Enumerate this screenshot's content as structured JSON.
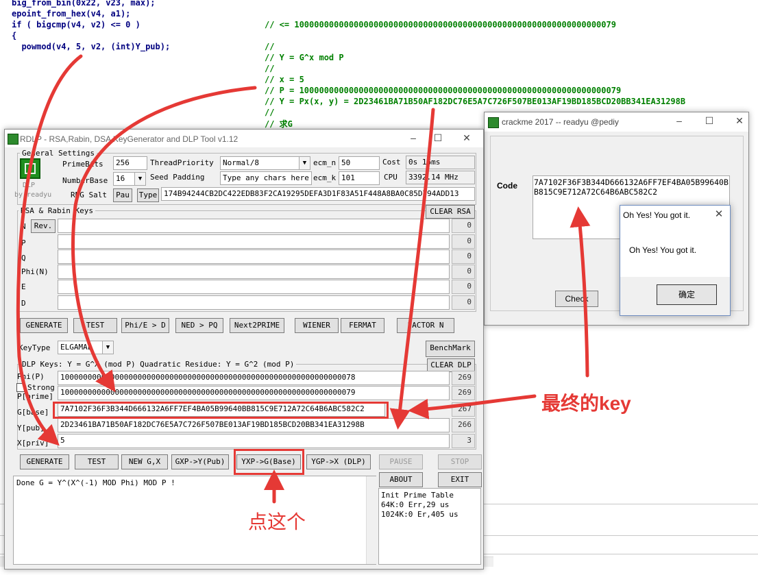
{
  "code": {
    "lines": [
      "big_from_bin(0x22, v23, max);",
      "epoint_from_hex(v4, a1);",
      "if ( bigcmp(v4, v2) <= 0 )",
      "{",
      "  powmod(v4, 5, v2, (int)Y_pub);"
    ],
    "comments": [
      "// <= 10000000000000000000000000000000000000000000000000000000000000079",
      "//",
      "// Y = G^x mod P",
      "//",
      "// x = 5",
      "// P = 10000000000000000000000000000000000000000000000000000000000000079",
      "// Y = Px(x, y) = 2D23461BA71B50AF182DC76E5A7C726F507BE013AF19BD185BCD20BB341EA31298B",
      "//",
      "// 求G"
    ]
  },
  "rdlp": {
    "title": "RDLP - RSA,Rabin, DSA KeyGenerator and DLP Tool v1.12",
    "logo_caption": "DLP",
    "author": "by readyu",
    "general": {
      "caption": "General Settings",
      "primebits_label": "PrimeBits",
      "primebits_value": "256",
      "threadpriority_label": "ThreadPriority",
      "threadpriority_value": "Normal/8",
      "ecm_n_label": "ecm_n",
      "ecm_n_value": "50",
      "cost_label": "Cost",
      "cost_value": "0s 16ms",
      "numberbase_label": "NumberBase",
      "numberbase_value": "16",
      "seedpadding_label": "Seed Padding",
      "seedpadding_value": "Type any chars here",
      "ecm_k_label": "ecm_k",
      "ecm_k_value": "101",
      "cpu_label": "CPU",
      "cpu_value": "3392.14 MHz",
      "rng_label": "RNG Salt",
      "pau_label": "Pau",
      "type_label": "Type",
      "rng_value": "174B94244CB2DC422EDB83F2CA19295DEFA3D1F83A51F448A8BA0C85D794ADD13"
    },
    "rsa": {
      "caption": "RSA & Rabin Keys",
      "clear_label": "CLEAR RSA",
      "rows": [
        {
          "label": "N",
          "value": "",
          "count": "0"
        },
        {
          "label": "P",
          "value": "",
          "count": "0"
        },
        {
          "label": "Q",
          "value": "",
          "count": "0"
        },
        {
          "label": "Phi(N)",
          "value": "",
          "count": "0"
        },
        {
          "label": "E",
          "value": "",
          "count": "0"
        },
        {
          "label": "D",
          "value": "",
          "count": "0"
        }
      ],
      "rev_label": "Rev.",
      "buttons": [
        "GENERATE",
        "TEST",
        "Phi/E > D",
        "NED > PQ",
        "Next2PRIME",
        "WIENER",
        "FERMAT",
        "FACTOR N"
      ]
    },
    "keytype": {
      "label": "KeyType",
      "value": "ELGAMAL",
      "benchmark": "BenchMark"
    },
    "dlp": {
      "caption": "DLP Keys: Y = G^X (mod P)  Quadratic Residue: Y = G^2 (mod P)",
      "clear_label": "CLEAR DLP",
      "strong_label": "Strong",
      "rows": [
        {
          "label": "Phi(P)",
          "value": "10000000000000000000000000000000000000000000000000000000000000078",
          "count": "269"
        },
        {
          "label": "P[prime]",
          "value": "10000000000000000000000000000000000000000000000000000000000000079",
          "count": "269"
        },
        {
          "label": "G[base]",
          "value": "7A7102F36F3B344D666132A6FF7EF4BA05B99640BB815C9E712A72C64B6ABC582C2",
          "count": "267"
        },
        {
          "label": "Y[pub]",
          "value": "2D23461BA71B50AF182DC76E5A7C726F507BE013AF19BD185BCD20BB341EA31298B",
          "count": "266"
        },
        {
          "label": "X[priv]",
          "value": "5",
          "count": "3"
        }
      ],
      "buttons": [
        "GENERATE",
        "TEST",
        "NEW G,X",
        "GXP->Y(Pub)",
        "YXP->G(Base)",
        "YGP->X (DLP)"
      ],
      "pause": "PAUSE",
      "stop": "STOP",
      "about": "ABOUT",
      "exit": "EXIT"
    },
    "log": "Done G = Y^(X^(-1) MOD Phi) MOD P !",
    "prime_table": "Init Prime Table\n64K:0 Err,29 us\n1024K:0 Er,405 us"
  },
  "crackme": {
    "title": "crackme 2017  --  readyu @pediy",
    "code_label": "Code",
    "code_value": "7A7102F36F3B344D666132A6FF7EF4BA05B99640BB815C9E712A72C64B6ABC582C2",
    "check_label": "Check"
  },
  "msgbox": {
    "title": "Oh Yes! You got it.",
    "message": "Oh Yes! You got it.",
    "ok_label": "确定"
  },
  "annotations": {
    "final_key": "最终的key",
    "click_this": "点这个",
    "color": "#e53935"
  }
}
